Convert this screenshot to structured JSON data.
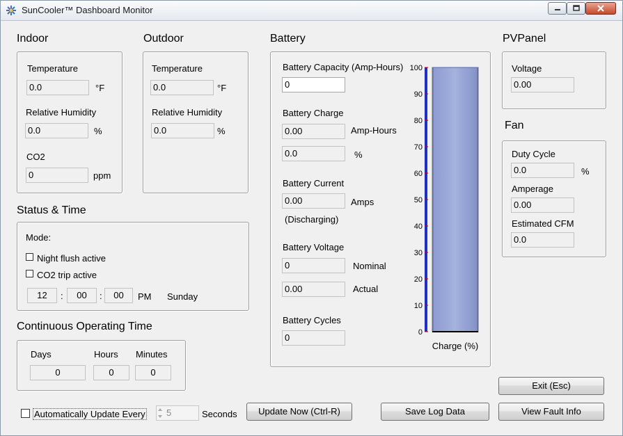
{
  "window": {
    "title": "SunCooler™ Dashboard Monitor"
  },
  "indoor": {
    "heading": "Indoor",
    "temperature_label": "Temperature",
    "temperature_value": "0.0",
    "temperature_unit": "°F",
    "humidity_label": "Relative Humidity",
    "humidity_value": "0.0",
    "humidity_unit": "%",
    "co2_label": "CO2",
    "co2_value": "0",
    "co2_unit": "ppm"
  },
  "outdoor": {
    "heading": "Outdoor",
    "temperature_label": "Temperature",
    "temperature_value": "0.0",
    "temperature_unit": "°F",
    "humidity_label": "Relative Humidity",
    "humidity_value": "0.0",
    "humidity_unit": "%"
  },
  "status": {
    "heading": "Status & Time",
    "mode_label": "Mode:",
    "night_flush_label": "Night flush active",
    "co2_trip_label": "CO2 trip active",
    "hour": "12",
    "minute": "00",
    "second": "00",
    "ampm": "PM",
    "day": "Sunday",
    "sep": ":"
  },
  "operating": {
    "heading": "Continuous Operating Time",
    "days_label": "Days",
    "hours_label": "Hours",
    "minutes_label": "Minutes",
    "days": "0",
    "hours": "0",
    "minutes": "0"
  },
  "battery": {
    "heading": "Battery",
    "capacity_label": "Battery Capacity (Amp-Hours)",
    "capacity_value": "0",
    "charge_label": "Battery Charge",
    "charge_ah": "0.00",
    "charge_ah_unit": "Amp-Hours",
    "charge_pct": "0.0",
    "charge_pct_unit": "%",
    "current_label": "Battery Current",
    "current_value": "0.00",
    "current_unit": "Amps",
    "current_state": "(Discharging)",
    "voltage_label": "Battery Voltage",
    "voltage_nominal": "0",
    "voltage_nominal_label": "Nominal",
    "voltage_actual": "0.00",
    "voltage_actual_label": "Actual",
    "cycles_label": "Battery Cycles",
    "cycles_value": "0"
  },
  "chart_data": {
    "type": "bar",
    "categories": [
      "Charge"
    ],
    "values": [
      100
    ],
    "xlabel": "Charge (%)",
    "ylabel": "",
    "ylim": [
      0,
      100
    ],
    "ticks": [
      "0",
      "10",
      "20",
      "30",
      "40",
      "50",
      "60",
      "70",
      "80",
      "90",
      "100"
    ],
    "bar_color": "#a4b2de",
    "axis_color": "#2030c0",
    "tick_color": "#c00000"
  },
  "pvpanel": {
    "heading": "PVPanel",
    "voltage_label": "Voltage",
    "voltage_value": "0.00"
  },
  "fan": {
    "heading": "Fan",
    "duty_label": "Duty Cycle",
    "duty_value": "0.0",
    "duty_unit": "%",
    "amperage_label": "Amperage",
    "amperage_value": "0.00",
    "cfm_label": "Estimated CFM",
    "cfm_value": "0.0"
  },
  "controls": {
    "auto_update_label": "Automatically Update Every",
    "interval_value": "5",
    "interval_unit": "Seconds",
    "update_now": "Update Now (Ctrl-R)",
    "save_log": "Save Log Data",
    "exit": "Exit (Esc)",
    "fault_info": "View Fault Info"
  }
}
